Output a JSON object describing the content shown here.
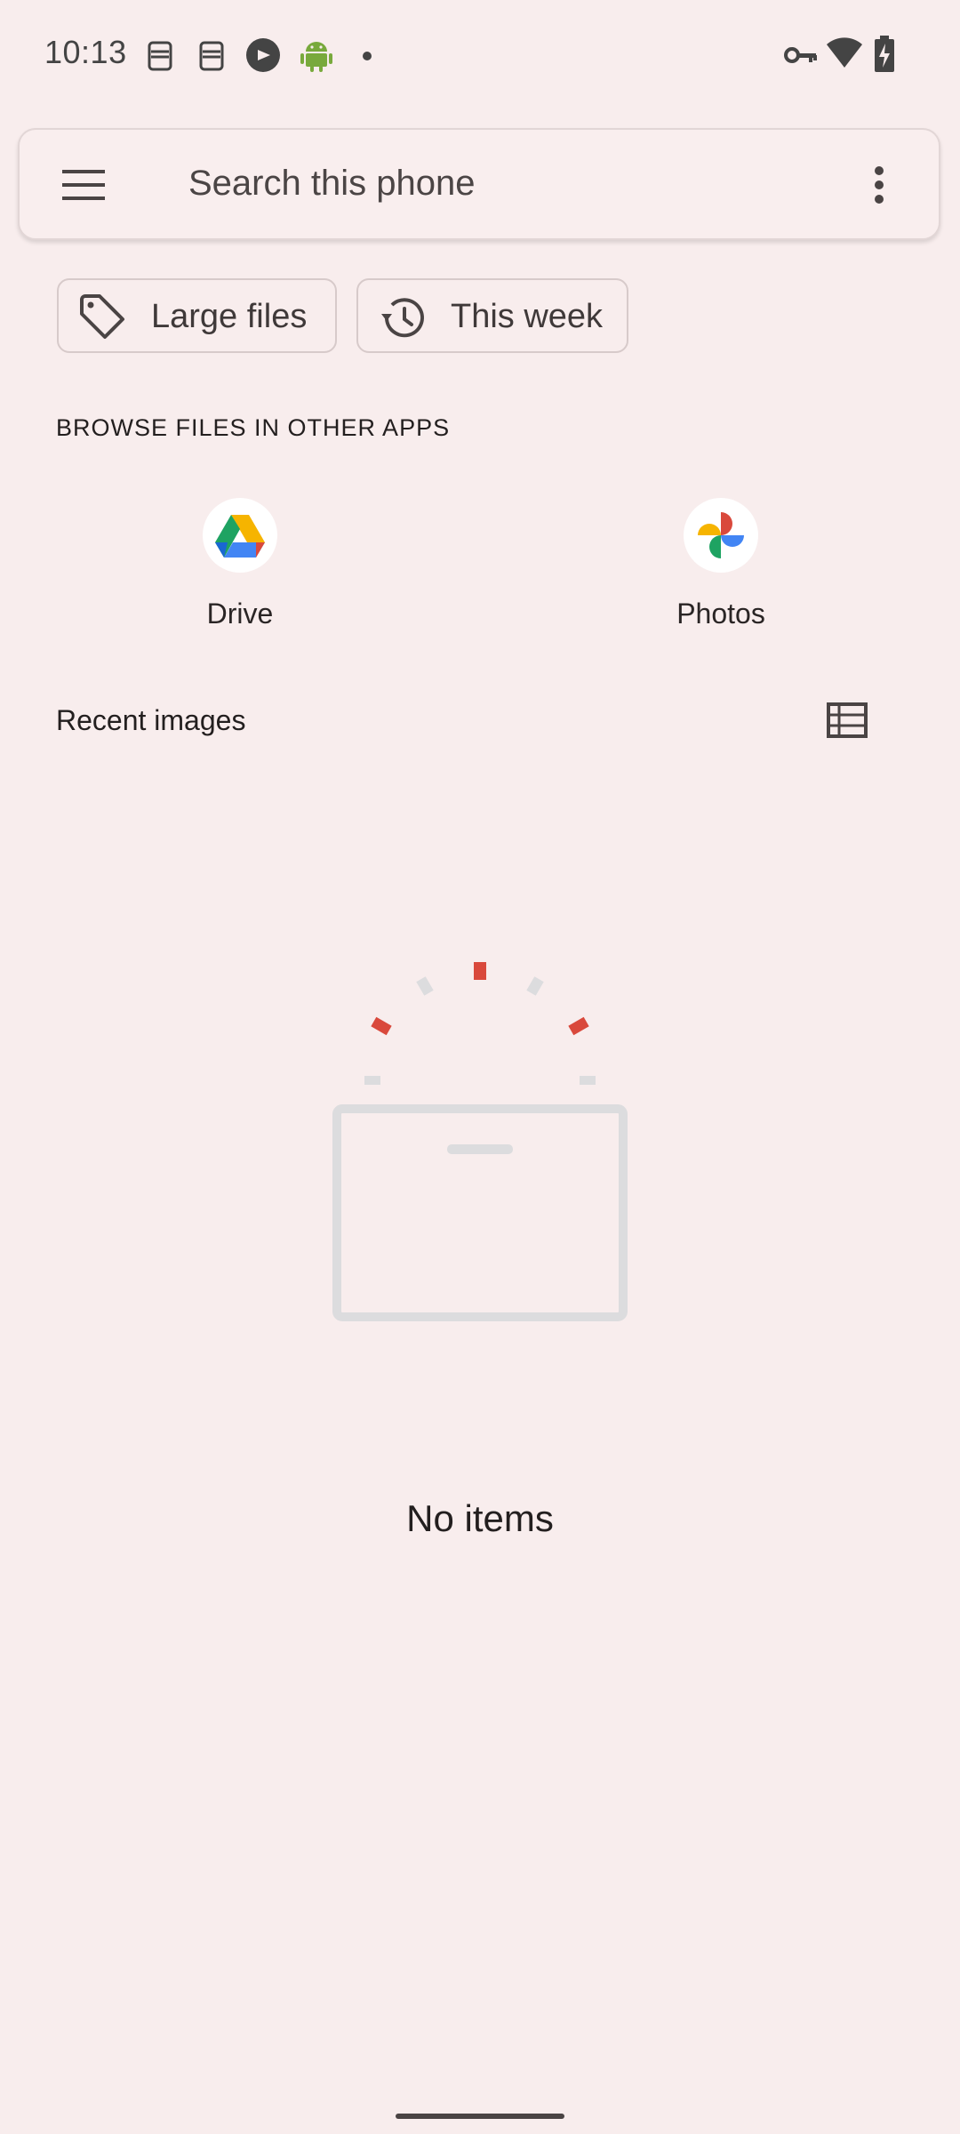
{
  "status_bar": {
    "time": "10:13",
    "icons": [
      "bot-icon",
      "bot-icon",
      "browser-icon",
      "android-icon",
      "dot-icon",
      "vpn-key-icon",
      "wifi-icon",
      "battery-charging-icon"
    ]
  },
  "search": {
    "placeholder": "Search this phone",
    "menu_icon": "hamburger-menu-icon",
    "overflow_icon": "more-vert-icon"
  },
  "chips": [
    {
      "label": "Large files",
      "icon": "tag-icon"
    },
    {
      "label": "This week",
      "icon": "history-icon"
    }
  ],
  "browse_section": {
    "title": "BROWSE FILES IN OTHER APPS",
    "apps": [
      {
        "label": "Drive",
        "icon": "google-drive-icon"
      },
      {
        "label": "Photos",
        "icon": "google-photos-icon"
      }
    ]
  },
  "recent": {
    "title": "Recent images",
    "view_toggle_icon": "list-view-icon"
  },
  "empty_state": {
    "message": "No items"
  },
  "colors": {
    "background": "#f8eded",
    "accent_red": "#d9493c",
    "illustration_grey": "#dcdcde",
    "android_green": "#78a93c"
  }
}
